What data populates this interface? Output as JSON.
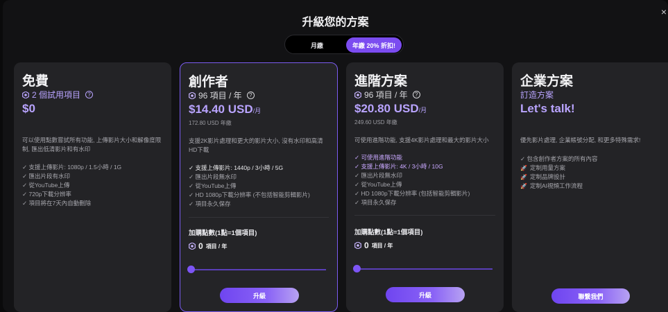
{
  "title": "升級您的方案",
  "close_icon_glyph": "×",
  "billing_toggle": {
    "monthly": "月繳",
    "yearly": "年繳 20% 折扣!"
  },
  "colors": {
    "accent": "#7b4cf0",
    "accent_light": "#b9a4ff",
    "card_bg": "#232326"
  },
  "plans": [
    {
      "name": "免費",
      "credits": "2 個試用項目",
      "price": "$0",
      "description": "可以使用點數嘗試所有功能, 上傳影片大小和解像度限制, 匯出低清影片和有水印",
      "features": [
        "支援上傳影片: 1080p / 1.5小時 / 1G",
        "匯出片段有水印",
        "從YouTube上傳",
        "720p下載分辨率",
        "項目將在7天內自動刪除"
      ]
    },
    {
      "name": "創作者",
      "credits": "96 項目 / 年",
      "price": "$14.40 USD",
      "price_per": "/月",
      "year_price": "172.80 USD 年繳",
      "description": "支援2K影片處理和更大的影片大小, 沒有水印和高清HD下載",
      "features": [
        "支援上傳影片: 1440p / 3小時 / 5G",
        "匯出片段無水印",
        "從YouTube上傳",
        "HD 1080p下載分辨率 (不包括智能剪輯影片)",
        "項目永久保存"
      ],
      "addon_title": "加購點數(1點=1個項目)",
      "addon_value": "0",
      "addon_unit": "項目 / 年",
      "addon_level": 0,
      "cta": "升級"
    },
    {
      "name": "進階方案",
      "credits": "96 項目 / 年",
      "price": "$20.80 USD",
      "price_per": "/月",
      "year_price": "249.60 USD 年繳",
      "description": "可使用進階功能, 支援4K影片處理和最大的影片大小",
      "features": [
        "可使用進階功能",
        "支援上傳影片: 4K / 3小時 / 10G",
        "匯出片段無水印",
        "從YouTube上傳",
        "HD 1080p下載分辨率 (包括智能剪輯影片)",
        "項目永久保存"
      ],
      "addon_title": "加購點數(1點=1個項目)",
      "addon_value": "0",
      "addon_unit": "項目 / 年",
      "addon_level": 0,
      "cta": "升級"
    },
    {
      "name": "企業方案",
      "subtitle": "訂造方案",
      "price": "Let's talk!",
      "description": "優先影片處理, 企業帳號分配, 和更多特殊需求!",
      "features": [
        "包含創作者方案的所有內容",
        "定制用量方案",
        "定制品牌設計",
        "定制AI視頻工作流程"
      ],
      "cta": "聯繫我們"
    }
  ]
}
